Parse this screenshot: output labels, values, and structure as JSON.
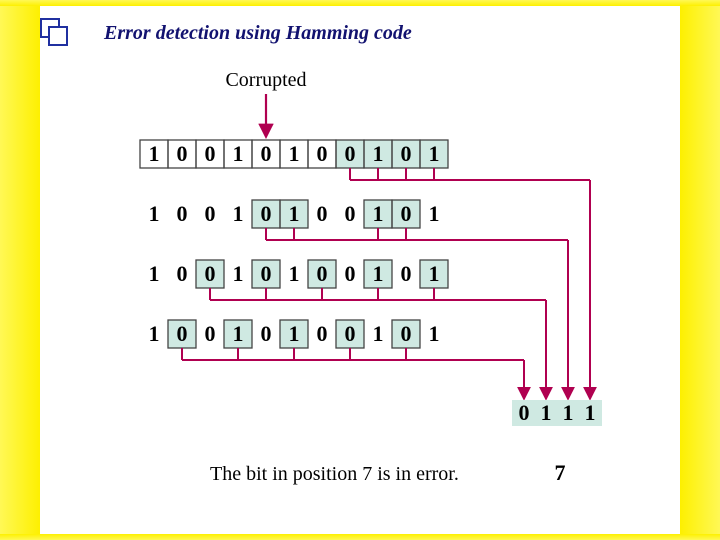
{
  "title": "Error detection using Hamming code",
  "corrupted_label": "Corrupted",
  "footer_text": "The bit in position 7 is in error.",
  "error_position": "7",
  "syndrome": [
    "0",
    "1",
    "1",
    "1"
  ],
  "syndrome_highlight": [
    1,
    1,
    1,
    1
  ],
  "rows": [
    {
      "bits": [
        "1",
        "0",
        "0",
        "1",
        "0",
        "1",
        "0",
        "0",
        "1",
        "0",
        "1"
      ],
      "highlight": [
        0,
        0,
        0,
        0,
        0,
        0,
        0,
        1,
        1,
        1,
        1
      ],
      "pickup": [
        0,
        0,
        0,
        0,
        0,
        0,
        0,
        1,
        1,
        1,
        1
      ],
      "boxed": 1
    },
    {
      "bits": [
        "1",
        "0",
        "0",
        "1",
        "0",
        "1",
        "0",
        "0",
        "1",
        "0",
        "1"
      ],
      "highlight": [
        0,
        0,
        0,
        0,
        1,
        1,
        0,
        0,
        1,
        1,
        0
      ],
      "pickup": [
        0,
        0,
        0,
        0,
        1,
        1,
        0,
        0,
        1,
        1,
        0
      ],
      "boxed": 0
    },
    {
      "bits": [
        "1",
        "0",
        "0",
        "1",
        "0",
        "1",
        "0",
        "0",
        "1",
        "0",
        "1"
      ],
      "highlight": [
        0,
        0,
        1,
        0,
        1,
        0,
        1,
        0,
        1,
        0,
        1
      ],
      "pickup": [
        0,
        0,
        1,
        0,
        1,
        0,
        1,
        0,
        1,
        0,
        1
      ],
      "boxed": 0
    },
    {
      "bits": [
        "1",
        "0",
        "0",
        "1",
        "0",
        "1",
        "0",
        "0",
        "1",
        "0",
        "1"
      ],
      "highlight": [
        0,
        1,
        0,
        1,
        0,
        1,
        0,
        1,
        0,
        1,
        0
      ],
      "pickup": [
        0,
        1,
        0,
        1,
        0,
        1,
        0,
        1,
        0,
        1,
        0
      ],
      "boxed": 0
    }
  ],
  "arrow_col": 4,
  "colors": {
    "line": "#b00050",
    "cell_stroke": "#444"
  }
}
